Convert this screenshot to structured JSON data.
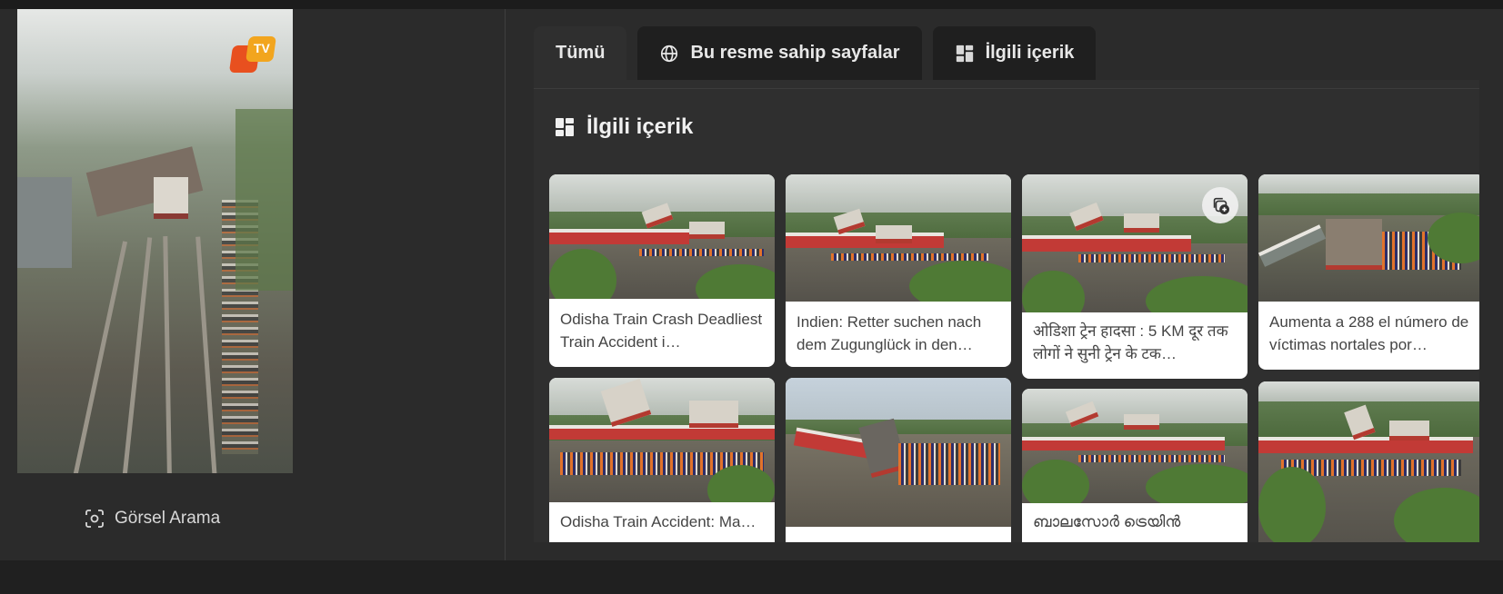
{
  "left": {
    "visual_search_label": "Görsel Arama",
    "preview_logo_text": "TV"
  },
  "tabs": [
    {
      "label": "Tümü",
      "icon": null,
      "active": true
    },
    {
      "label": "Bu resme sahip sayfalar",
      "icon": "globe-icon",
      "active": false
    },
    {
      "label": "İlgili içerik",
      "icon": "grid-icon",
      "active": false
    }
  ],
  "panel": {
    "title": "İlgili içerik",
    "cards": [
      {
        "caption": "Odisha Train Crash Deadliest Train Accident i…"
      },
      {
        "caption": "Indien: Retter suchen nach dem Zugunglück in den…"
      },
      {
        "caption": "ओडिशा ट्रेन हादसा : 5 KM दूर तक लोगों ने सुनी ट्रेन के टक…"
      },
      {
        "caption": "Aumenta a 288 el número de víctimas nortales por…"
      },
      {
        "caption": "Odisha Train Accident: Ma…"
      },
      {
        "caption": ""
      },
      {
        "caption": "ബാലസോർ ട്രെയിൻ"
      },
      {
        "caption": ""
      }
    ]
  },
  "colors": {
    "background": "#2b2b2b",
    "tab_bg": "#1f1f1f",
    "tab_active_bg": "#2f2f2f",
    "card_bg": "#ffffff"
  }
}
